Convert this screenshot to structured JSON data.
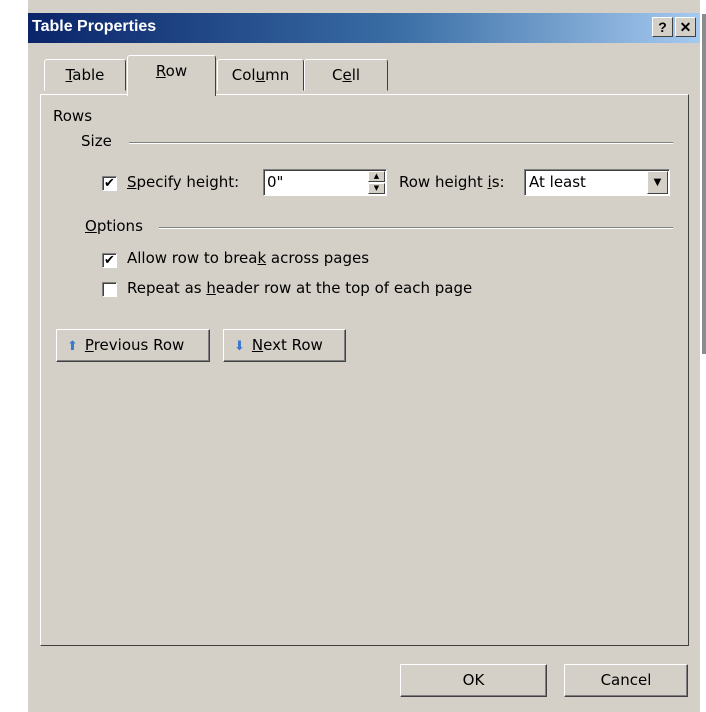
{
  "window": {
    "title": "Table Properties",
    "help_glyph": "?",
    "close_glyph": "✕"
  },
  "tabs": [
    {
      "label_pre": "",
      "mnemonic": "T",
      "label_post": "able"
    },
    {
      "label_pre": "",
      "mnemonic": "R",
      "label_post": "ow"
    },
    {
      "label_pre": "Col",
      "mnemonic": "u",
      "label_post": "mn"
    },
    {
      "label_pre": "C",
      "mnemonic": "e",
      "label_post": "ll"
    }
  ],
  "active_tab": "Row",
  "rows": {
    "heading": "Rows",
    "size_label": "Size",
    "specify_height": {
      "checked": true,
      "label_pre": "",
      "mnemonic": "S",
      "label_post": "pecify height:"
    },
    "height_value": "0\"",
    "row_height_is": {
      "label_pre": "Row height ",
      "mnemonic": "i",
      "label_post": "s:"
    },
    "row_height_mode": "At least",
    "options_label": {
      "label_pre": "",
      "mnemonic": "O",
      "label_post": "ptions"
    },
    "allow_break": {
      "checked": true,
      "label_pre": "Allow row to brea",
      "mnemonic": "k",
      "label_post": " across pages"
    },
    "repeat_header": {
      "checked": false,
      "label_pre": "Repeat as ",
      "mnemonic": "h",
      "label_post": "eader row at the top of each page"
    }
  },
  "nav": {
    "previous": {
      "label_pre": "",
      "mnemonic": "P",
      "label_post": "revious Row",
      "icon": "arrow-up-icon"
    },
    "next": {
      "label_pre": "",
      "mnemonic": "N",
      "label_post": "ext Row",
      "icon": "arrow-down-icon"
    }
  },
  "footer": {
    "ok": "OK",
    "cancel": "Cancel"
  },
  "colors": {
    "dialog_bg": "#d4d0c8",
    "title_start": "#0a246a",
    "title_end": "#a6caf0",
    "nav_icon": "#3a78d0"
  }
}
